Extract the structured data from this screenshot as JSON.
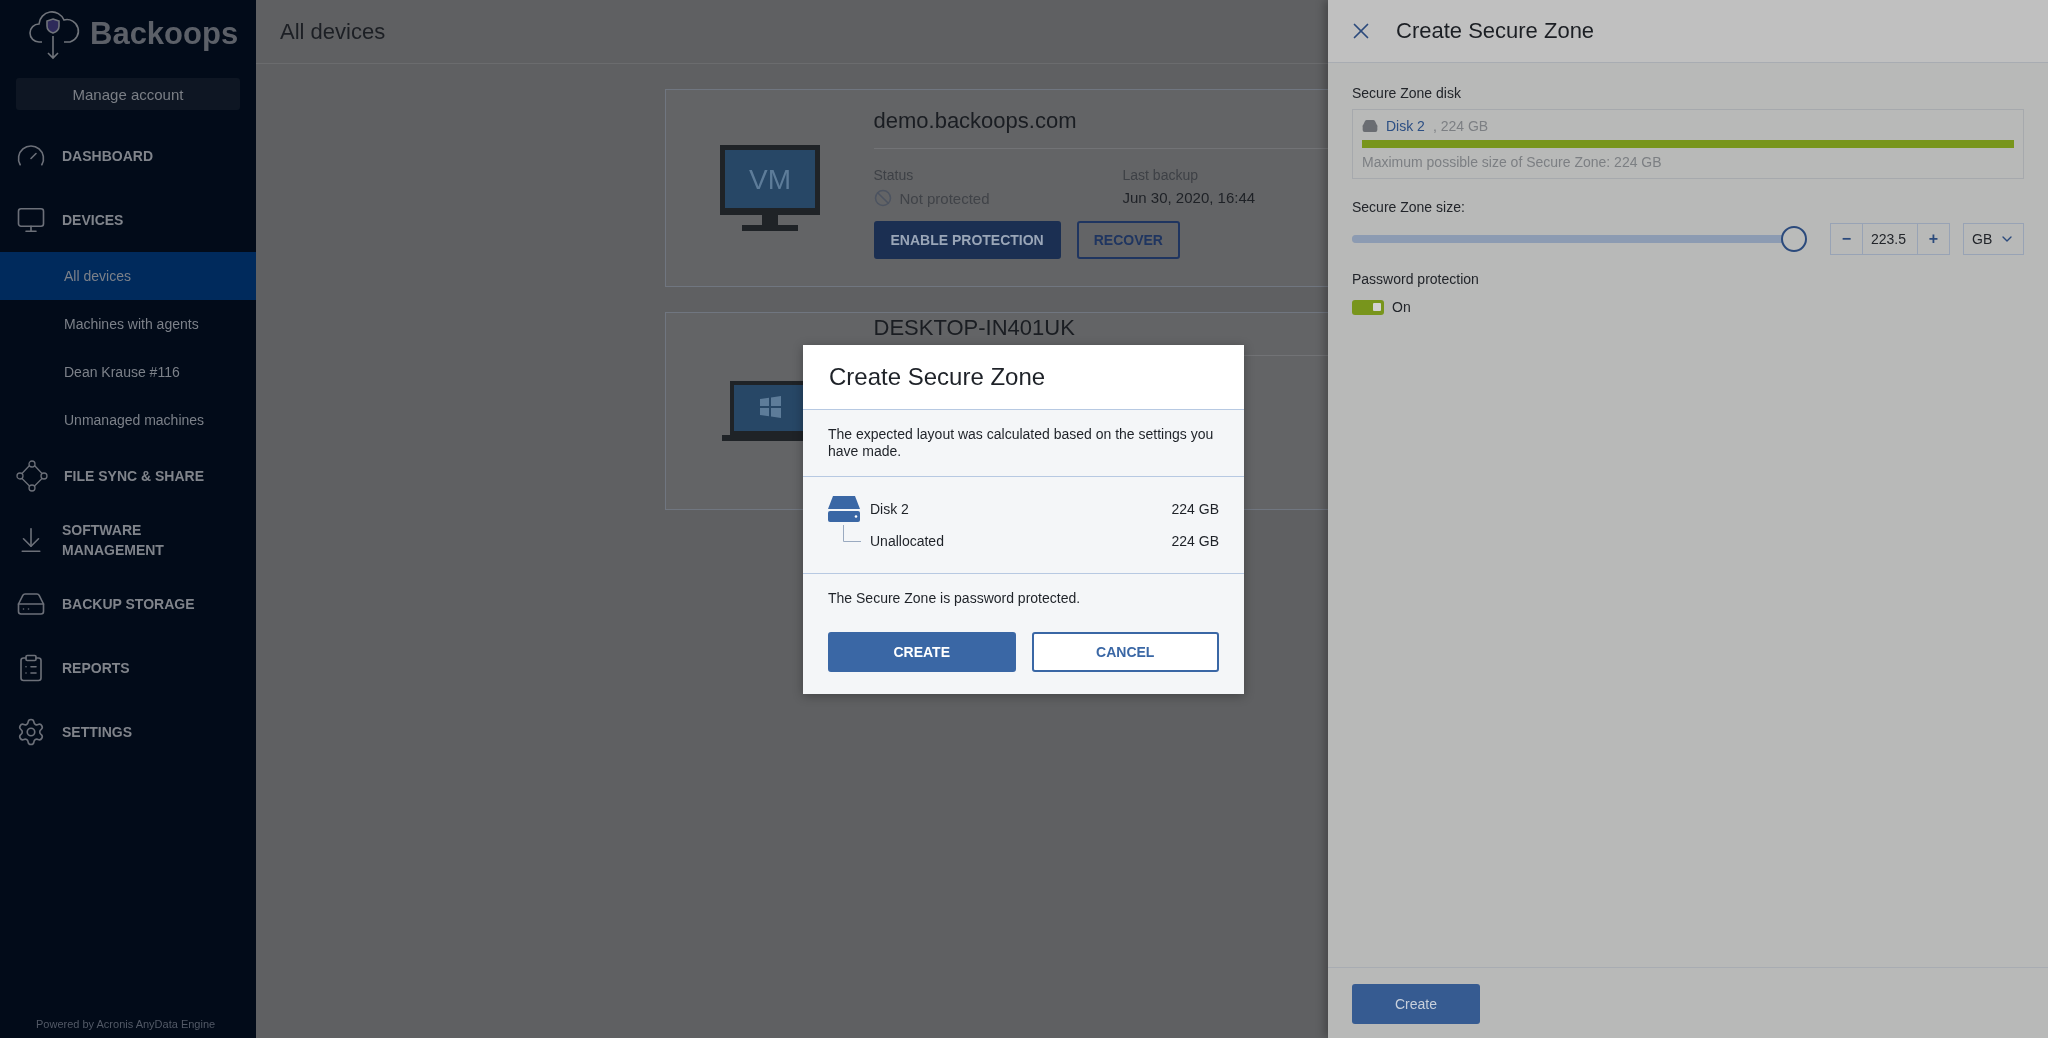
{
  "sidebar": {
    "logo_text": "Backoops",
    "manage_account": "Manage account",
    "items": [
      {
        "label": "DASHBOARD",
        "selected": false
      },
      {
        "label": "DEVICES",
        "selected": false,
        "children": [
          {
            "label": "All devices",
            "selected": true
          },
          {
            "label": "Machines with agents",
            "selected": false
          },
          {
            "label": "Dean Krause #116",
            "selected": false
          },
          {
            "label": "Unmanaged machines",
            "selected": false
          }
        ]
      },
      {
        "label": "FILE SYNC & SHARE",
        "selected": false
      },
      {
        "label": "SOFTWARE MANAGEMENT",
        "selected": false
      },
      {
        "label": "BACKUP STORAGE",
        "selected": false
      },
      {
        "label": "REPORTS",
        "selected": false
      },
      {
        "label": "SETTINGS",
        "selected": false
      }
    ],
    "footer": "Powered by Acronis AnyData Engine"
  },
  "header": {
    "title": "All devices"
  },
  "devices": [
    {
      "kind": "vm",
      "name": "demo.backoops.com",
      "icon_text": "VM",
      "status_label": "Status",
      "status": "Not protected",
      "last_backup_label": "Last backup",
      "last_backup": "Jun 30, 2020, 16:44",
      "buttons": [
        "ENABLE PROTECTION",
        "RECOVER"
      ]
    },
    {
      "kind": "laptop",
      "name": "DESKTOP-IN401UK"
    }
  ],
  "dialog": {
    "title": "Create Secure Zone",
    "message": "The expected layout was calculated based on the settings you have made.",
    "disk": {
      "name": "Disk 2",
      "size": "224 GB"
    },
    "partitions": [
      {
        "name": "Unallocated",
        "size": "224 GB"
      }
    ],
    "note": "The Secure Zone is password protected.",
    "buttons": [
      "CREATE",
      "CANCEL"
    ]
  },
  "drawer": {
    "title": "Create Secure Zone",
    "disk_label": "Secure Zone disk",
    "disk": {
      "name": "Disk 2",
      "detail": ", 224 GB",
      "level": 1,
      "max_text": "Maximum possible size of Secure Zone: 224 GB"
    },
    "size_label": "Secure Zone size:",
    "size": {
      "level": 0.998,
      "minus": "−",
      "value": "223.5",
      "plus": "+",
      "unit": "GB"
    },
    "password_label": "Password protection",
    "password": {
      "on": true,
      "label": "On"
    },
    "button": "Create"
  }
}
